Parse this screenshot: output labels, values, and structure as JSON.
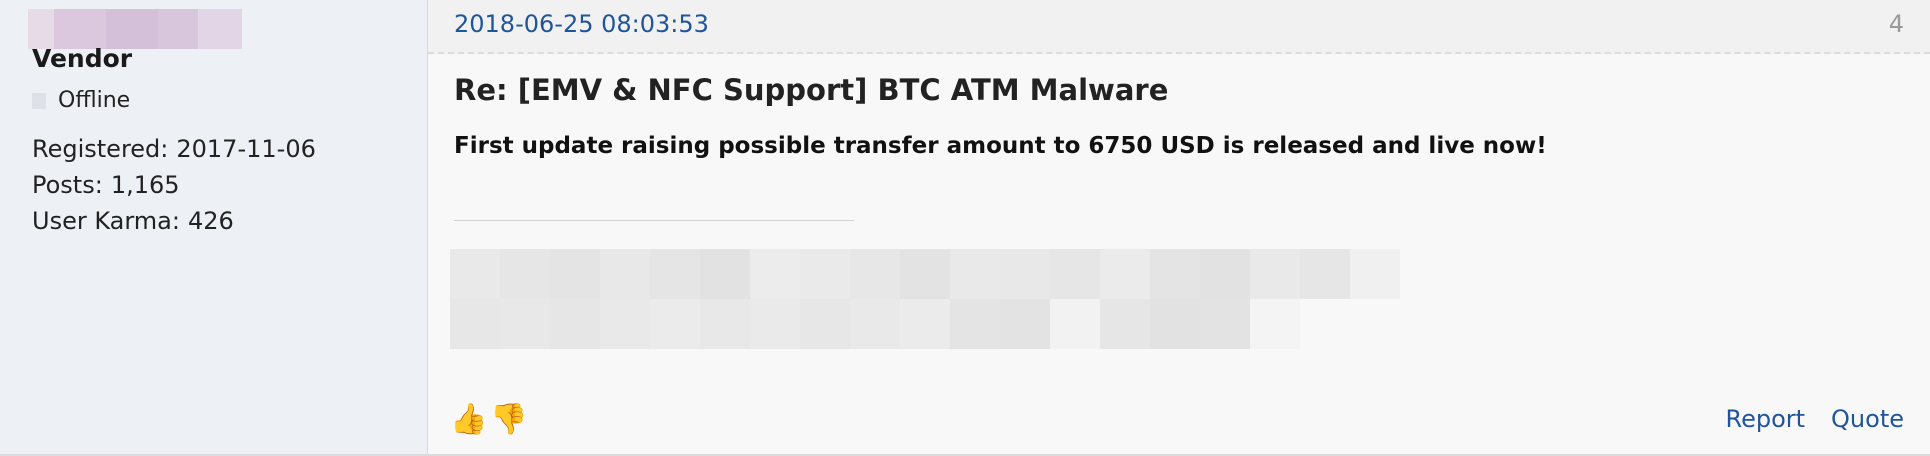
{
  "user": {
    "name": "Vendor",
    "status": "Offline",
    "stats": [
      {
        "label": "Registered:",
        "value": "2017-11-06"
      },
      {
        "label": "Posts:",
        "value": "1,165"
      },
      {
        "label": "User Karma:",
        "value": "426"
      }
    ]
  },
  "post": {
    "date": "2018-06-25 08:03:53",
    "number": "4",
    "title": "Re: [EMV & NFC Support] BTC ATM Malware",
    "body": "First update raising possible transfer amount to 6750 USD is released and live now!",
    "vote_up_icon": "thumbs-up-icon",
    "vote_down_icon": "thumbs-down-icon"
  },
  "actions": {
    "report_label": "Report",
    "quote_label": "Quote"
  },
  "colors": {
    "link": "#20559a",
    "sidebar_bg": "#edf0f5",
    "header_bg": "#f1f1f1",
    "avatar_blur": "#d9c6dd"
  }
}
